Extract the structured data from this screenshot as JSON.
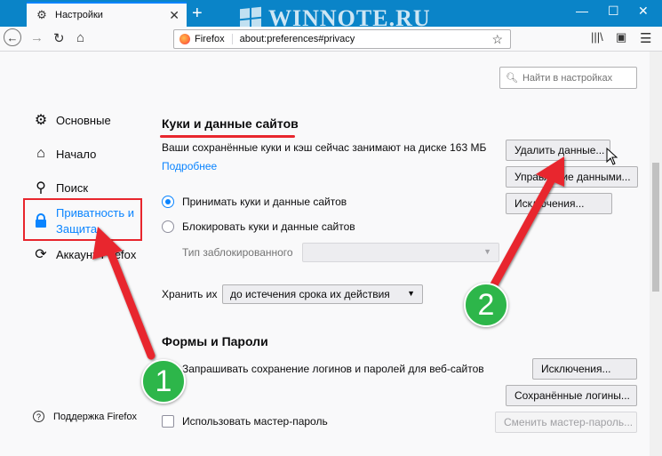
{
  "browser": {
    "tab_title": "Настройки",
    "watermark": "WINNOTE.RU",
    "identity": "Firefox",
    "url": "about:preferences#privacy"
  },
  "search": {
    "placeholder": "Найти в настройках"
  },
  "sidebar": {
    "items": [
      {
        "label": "Основные"
      },
      {
        "label": "Начало"
      },
      {
        "label": "Поиск"
      },
      {
        "label": "Приватность и Защита"
      },
      {
        "label": "Аккаунт Firefox"
      }
    ],
    "support": "Поддержка Firefox"
  },
  "cookies": {
    "heading": "Куки и данные сайтов",
    "usage_text": "Ваши сохранённые куки и кэш сейчас занимают на диске 163 МБ",
    "learn_more": "Подробнее",
    "clear_button": "Удалить данные...",
    "manage_button": "Управление данными...",
    "exceptions_button": "Исключения...",
    "accept_label": "Принимать куки и данные сайтов",
    "block_label": "Блокировать куки и данные сайтов",
    "block_type_label": "Тип заблокированного",
    "keep_label": "Хранить их",
    "keep_value": "до истечения срока их действия"
  },
  "forms": {
    "heading": "Формы и Пароли",
    "ask_save_label": "Запрашивать сохранение логинов и паролей для веб-сайтов",
    "exceptions_button": "Исключения...",
    "saved_logins_button": "Сохранённые логины...",
    "master_password_label": "Использовать мастер-пароль",
    "change_master_button": "Сменить мастер-пароль..."
  },
  "annotations": {
    "step1": "1",
    "step2": "2",
    "accent_red": "#e8262d",
    "badge_green": "#2db64a"
  }
}
